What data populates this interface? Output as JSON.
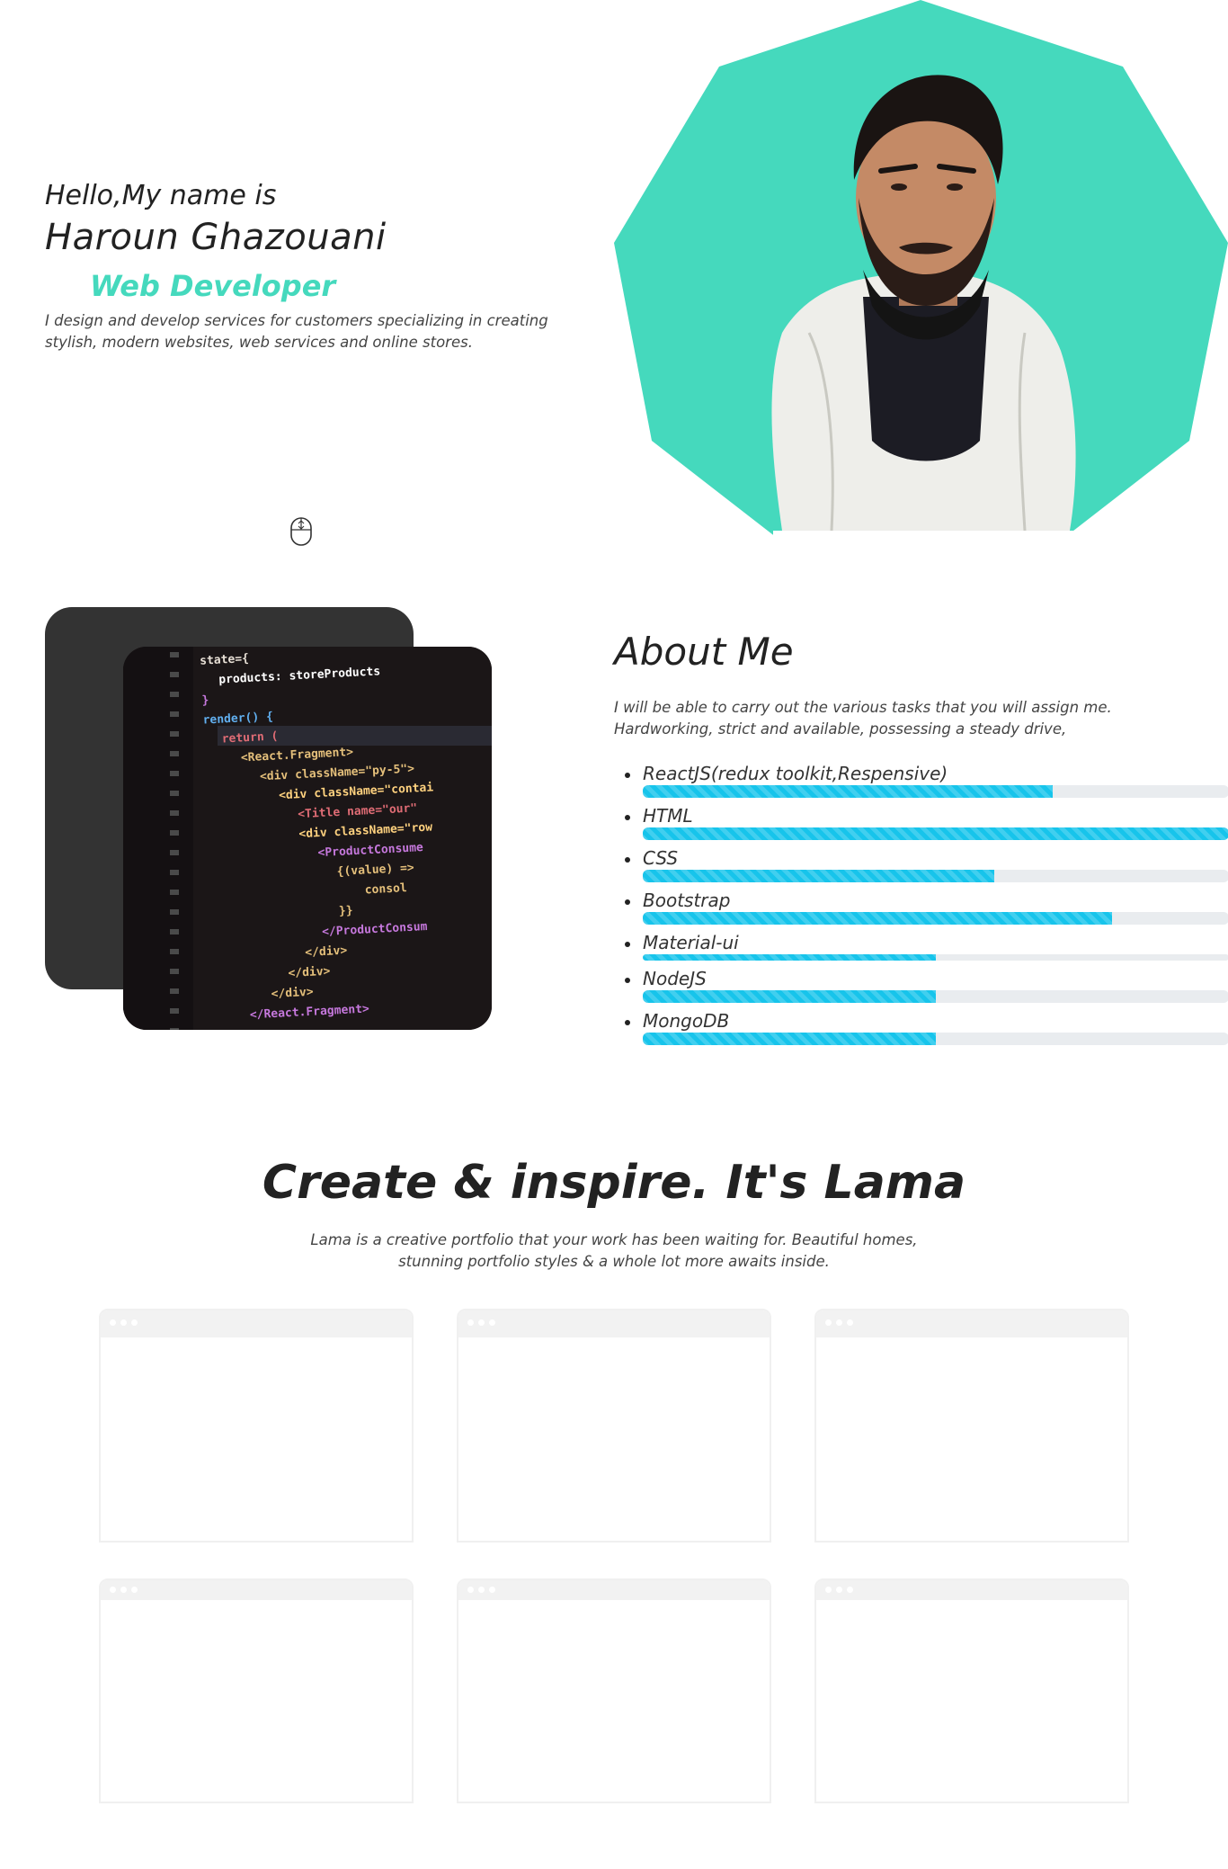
{
  "hero": {
    "intro": "Hello,My name is",
    "name": "Haroun Ghazouani",
    "role": "Web Developer",
    "description": "I design and develop services for customers specializing in creating stylish, modern websites, web services and online stores.",
    "accent_color": "#45d9bd",
    "scroll_icon": "mouse-scroll-icon",
    "image": "portrait-photo"
  },
  "about": {
    "title": "About Me",
    "description": "I will be able to carry out the various tasks that you will assign me. Hardworking, strict and available, possessing a steady drive,",
    "images": [
      "dark-card",
      "code-screenshot"
    ],
    "skills": [
      {
        "name": "ReactJS(redux toolkit,Respensive)",
        "level": 0.7
      },
      {
        "name": "HTML",
        "level": 1.0
      },
      {
        "name": "CSS",
        "level": 0.6
      },
      {
        "name": "Bootstrap",
        "level": 0.8
      },
      {
        "name": "Material-ui",
        "level": 0.5
      },
      {
        "name": "NodeJS",
        "level": 0.5
      },
      {
        "name": "MongoDB",
        "level": 0.5
      }
    ],
    "bar_color": "#17c4eb"
  },
  "products": {
    "title": "Create & inspire. It's Lama",
    "description": "Lama is a creative portfolio that your work has been waiting for. Beautiful homes, stunning portfolio styles & a whole lot more awaits inside.",
    "cards": [
      {
        "image": "project-preview-1"
      },
      {
        "image": "project-preview-2"
      },
      {
        "image": "project-preview-3"
      },
      {
        "image": "project-preview-4"
      },
      {
        "image": "project-preview-5"
      },
      {
        "image": "project-preview-6"
      }
    ]
  },
  "code_snippet": [
    "state={",
    "products: storeProducts",
    "}",
    "render() {",
    "return (",
    "<React.Fragment>",
    "<div className=\"py-5\">",
    "<div className=\"contai",
    "<Title name=\"our\"",
    "<div className=\"row",
    "<ProductConsume",
    "{(value) =>",
    "consol",
    "}}",
    "</ProductConsum",
    "</div>",
    "</div>",
    "</div>",
    "</React.Fragment>"
  ]
}
